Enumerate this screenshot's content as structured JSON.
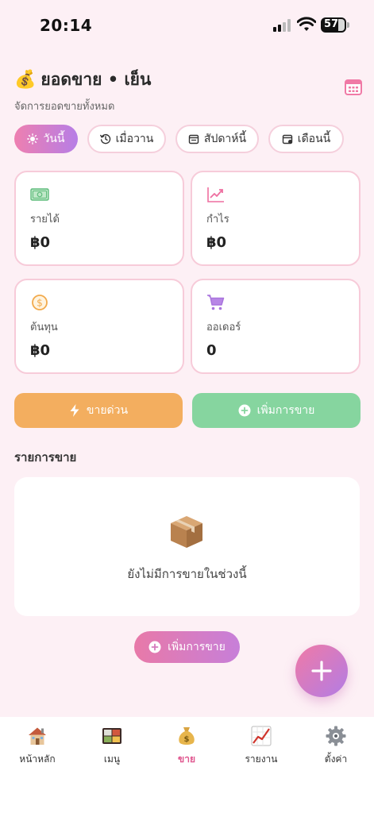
{
  "status_bar": {
    "time": "20:14",
    "battery": "57"
  },
  "header": {
    "title_emoji": "💰",
    "title": "ยอดขาย • เย็น",
    "subtitle": "จัดการยอดขายทั้งหมด",
    "calendar_icon": "calendar-icon"
  },
  "filters": [
    {
      "label": "วันนี้",
      "icon": "sun-icon",
      "active": true
    },
    {
      "label": "เมื่อวาน",
      "icon": "history-icon",
      "active": false
    },
    {
      "label": "สัปดาห์นี้",
      "icon": "calendar-week-icon",
      "active": false
    },
    {
      "label": "เดือนนี้",
      "icon": "calendar-month-icon",
      "active": false
    }
  ],
  "cards": {
    "revenue": {
      "label": "รายได้",
      "value": "฿0",
      "icon": "cash-icon"
    },
    "profit": {
      "label": "กำไร",
      "value": "฿0",
      "icon": "trend-up-icon"
    },
    "cost": {
      "label": "ต้นทุน",
      "value": "฿0",
      "icon": "coin-icon"
    },
    "orders": {
      "label": "ออเดอร์",
      "value": "0",
      "icon": "cart-icon"
    }
  },
  "actions": {
    "quick_sell": "ขายด่วน",
    "add_sale": "เพิ่มการขาย"
  },
  "sales_list": {
    "title": "รายการขาย",
    "empty_text": "ยังไม่มีการขายในช่วงนี้",
    "empty_icon": "package-icon"
  },
  "add_sale_pill": "เพิ่มการขาย",
  "fab": {
    "icon": "plus-icon"
  },
  "tabs": [
    {
      "label": "หน้าหลัก",
      "icon": "house-icon",
      "active": false
    },
    {
      "label": "เมนู",
      "icon": "bento-icon",
      "active": false
    },
    {
      "label": "ขาย",
      "icon": "money-bag-icon",
      "active": true
    },
    {
      "label": "รายงาน",
      "icon": "chart-icon",
      "active": false
    },
    {
      "label": "ตั้งค่า",
      "icon": "gear-icon",
      "active": false
    }
  ],
  "colors": {
    "background": "#fdf0f5",
    "accent_pink": "#e0578f",
    "gradient_start": "#ee7fb0",
    "gradient_end": "#b67ee6",
    "quick_sell": "#f3ae5f",
    "add_sale": "#86d59f",
    "card_border": "#f7cbd9"
  }
}
